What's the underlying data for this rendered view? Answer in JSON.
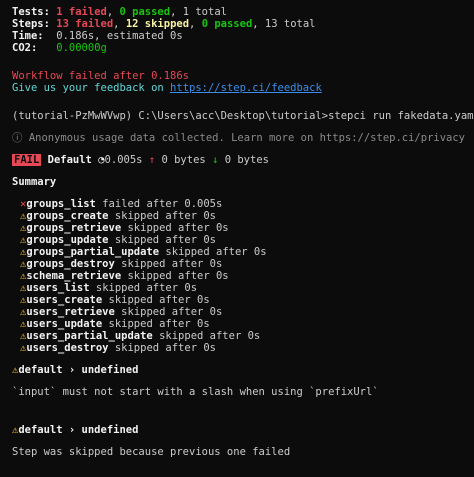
{
  "summary": {
    "tests_label": "Tests:",
    "tests_failed": "1 failed",
    "tests_sep1": ", ",
    "tests_passed": "0 passed",
    "tests_rest": ", 1 total",
    "steps_label": "Steps:",
    "steps_failed": "13 failed",
    "steps_sep1": ", ",
    "steps_skipped": "12 skipped",
    "steps_sep2": ", ",
    "steps_passed": "0 passed",
    "steps_rest": ", 13 total",
    "time_label": "Time:",
    "time_value": "  0.186s, estimated 0s",
    "co2_label": "CO2:",
    "co2_value": "   0.00000g"
  },
  "workflow_failed": "Workflow failed after 0.186s",
  "feedback": {
    "text": "Give us your feedback on ",
    "link": "https://step.ci/feedback"
  },
  "prompt": {
    "env": "(tutorial-PzMwWVwp) C:\\Users\\acc\\Desktop\\tutorial>",
    "command": "stepci run fakedata.yaml"
  },
  "anon_notice": "ⓘ Anonymous usage data collected. Learn more on https://step.ci/privacy",
  "result": {
    "badge": "FAIL",
    "name": "Default",
    "timer_icon": "◔",
    "duration": "0.005s",
    "up_arrow": "↑",
    "sent": "0 bytes",
    "down_arrow": "↓",
    "received": "0 bytes"
  },
  "summary_heading": "Summary",
  "steps": [
    {
      "icon": "✕",
      "name": "groups_list",
      "status": "failed after 0.005s"
    },
    {
      "icon": "⚠",
      "name": "groups_create",
      "status": "skipped after 0s"
    },
    {
      "icon": "⚠",
      "name": "groups_retrieve",
      "status": "skipped after 0s"
    },
    {
      "icon": "⚠",
      "name": "groups_update",
      "status": "skipped after 0s"
    },
    {
      "icon": "⚠",
      "name": "groups_partial_update",
      "status": "skipped after 0s"
    },
    {
      "icon": "⚠",
      "name": "groups_destroy",
      "status": "skipped after 0s"
    },
    {
      "icon": "⚠",
      "name": "schema_retrieve",
      "status": "skipped after 0s"
    },
    {
      "icon": "⚠",
      "name": "users_list",
      "status": "skipped after 0s"
    },
    {
      "icon": "⚠",
      "name": "users_create",
      "status": "skipped after 0s"
    },
    {
      "icon": "⚠",
      "name": "users_retrieve",
      "status": "skipped after 0s"
    },
    {
      "icon": "⚠",
      "name": "users_update",
      "status": "skipped after 0s"
    },
    {
      "icon": "⚠",
      "name": "users_partial_update",
      "status": "skipped after 0s"
    },
    {
      "icon": "⚠",
      "name": "users_destroy",
      "status": "skipped after 0s"
    }
  ],
  "error1": {
    "icon": "⚠",
    "path": "default › undefined",
    "message": "`input` must not start with a slash when using `prefixUrl`"
  },
  "error2": {
    "icon": "⚠",
    "path": "default › undefined",
    "message": "Step was skipped because previous one failed"
  }
}
